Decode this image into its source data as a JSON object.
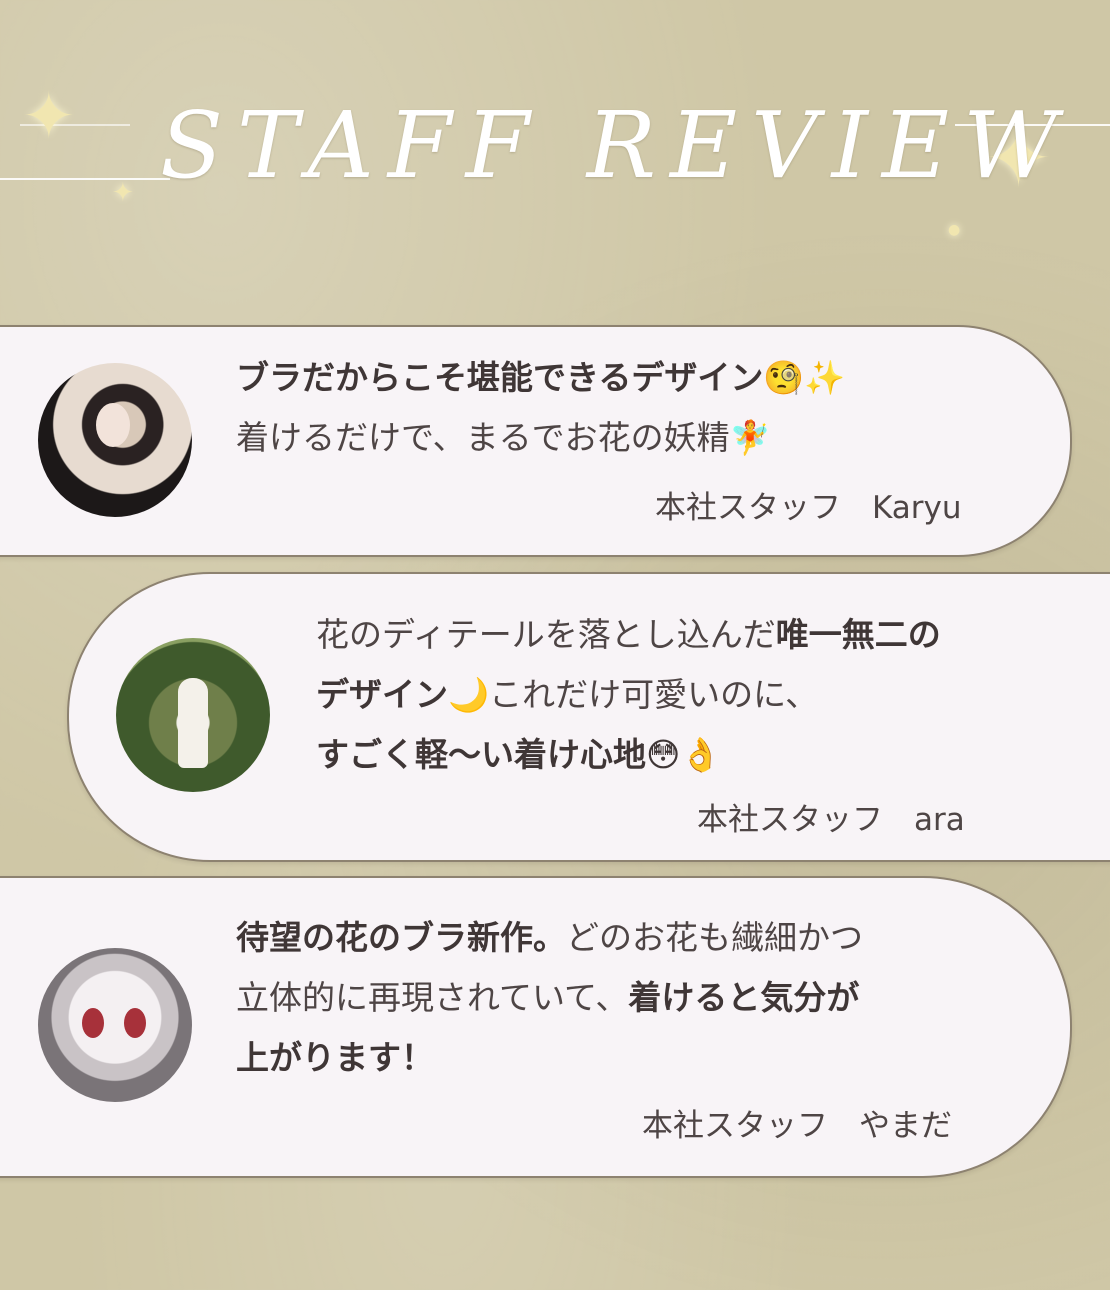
{
  "header": {
    "title": "STAFF REVIEW"
  },
  "reviews": [
    {
      "line1_bold": "ブラだからこそ堪能できるデザイン🧐✨",
      "line2": "着けるだけで、まるでお花の妖精🧚",
      "author": "本社スタッフ　Karyu"
    },
    {
      "line1_normal": "花のディテールを落とし込んだ",
      "line1_bold": "唯一無二の",
      "line2_bold": "デザイン🌙",
      "line2_normal": "これだけ可愛いのに、",
      "line3_bold": "すごく軽〜い着け心地😳👌",
      "author": "本社スタッフ　ara"
    },
    {
      "line1_bold": "待望の花のブラ新作。",
      "line1_normal": "どのお花も繊細かつ",
      "line2_normal": "立体的に再現されていて、",
      "line2_bold": "着けると気分が",
      "line3_bold": "上がります！",
      "author": "本社スタッフ　やまだ"
    }
  ]
}
